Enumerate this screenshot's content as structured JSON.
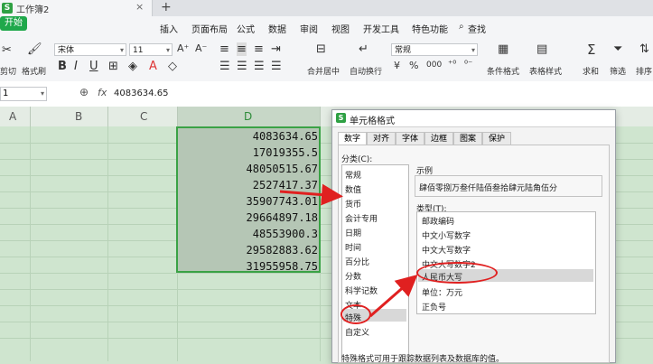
{
  "titlebar": {
    "doc_name": "工作簿2",
    "close": "×",
    "new_tab": "+",
    "app_icon": "S"
  },
  "menu": {
    "items": [
      "开始",
      "插入",
      "页面布局",
      "公式",
      "数据",
      "审阅",
      "视图",
      "开发工具",
      "特色功能"
    ],
    "search": "查找"
  },
  "toolbar": {
    "cut": "剪切",
    "format_painter": "格式刷",
    "font_name": "宋体",
    "font_size": "11",
    "number_format": "常规",
    "merge": "合并居中",
    "wrap": "自动换行",
    "cond_format": "条件格式",
    "table_style": "表格样式",
    "sum": "求和",
    "filter": "筛选",
    "sort": "排序",
    "bold": "B",
    "italic": "I",
    "underline": "U",
    "grow_font": "A⁺",
    "shrink_font": "A⁻",
    "percent": "%",
    "thousands": "000"
  },
  "formula_bar": {
    "cell_ref": "1",
    "fx": "fx",
    "value": "4083634.65"
  },
  "columns": [
    "A",
    "B",
    "C",
    "D"
  ],
  "cells": [
    "4083634.65",
    "17019355.5",
    "48050515.67",
    "2527417.37",
    "35907743.01",
    "29664897.18",
    "48553900.3",
    "29582883.62",
    "31955958.75"
  ],
  "dialog": {
    "title": "单元格格式",
    "tabs": [
      "数字",
      "对齐",
      "字体",
      "边框",
      "图案",
      "保护"
    ],
    "category_label": "分类(C):",
    "categories": [
      "常规",
      "数值",
      "货币",
      "会计专用",
      "日期",
      "时间",
      "百分比",
      "分数",
      "科学记数",
      "文本",
      "特殊",
      "自定义"
    ],
    "example_label": "示例",
    "example_text": "肆佰零捌万叁仟陆佰叁拾肆元陆角伍分",
    "type_label": "类型(T):",
    "types": [
      "邮政编码",
      "中文小写数字",
      "中文大写数字",
      "中文大写数字2",
      "人民币大写",
      "单位：万元",
      "正负号"
    ],
    "description": "特殊格式可用于跟踪数据列表及数据库的值。"
  },
  "colors": {
    "accent": "#1fa84b",
    "annotation": "#e02020",
    "grid_bg": "#cfe5cf"
  }
}
